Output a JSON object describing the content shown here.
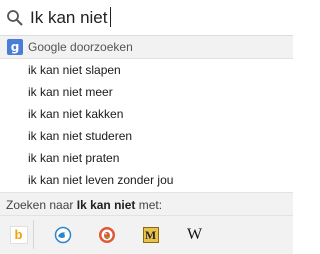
{
  "search": {
    "query": "Ik kan niet"
  },
  "engine_row": {
    "logo_letter": "g",
    "label": "Google doorzoeken"
  },
  "suggestions": [
    "ik kan niet slapen",
    "ik kan niet meer",
    "ik kan niet kakken",
    "ik kan niet studeren",
    "ik kan niet praten",
    "ik kan niet leven zonder jou"
  ],
  "alt_search": {
    "prefix": "Zoeken naar",
    "query": "Ik kan niet",
    "suffix": "met:"
  },
  "engines": [
    {
      "name": "bing-icon",
      "glyph": "b"
    },
    {
      "name": "blue-bird-icon",
      "glyph": ""
    },
    {
      "name": "duckduckgo-icon",
      "glyph": ""
    },
    {
      "name": "m-icon",
      "glyph": "M"
    },
    {
      "name": "wikipedia-icon",
      "glyph": "W"
    }
  ],
  "colors": {
    "google_blue": "#4a7cd8",
    "bing_orange": "#f0a30a",
    "duckduckgo_orange": "#de5833",
    "bird_blue": "#2f86c7"
  }
}
